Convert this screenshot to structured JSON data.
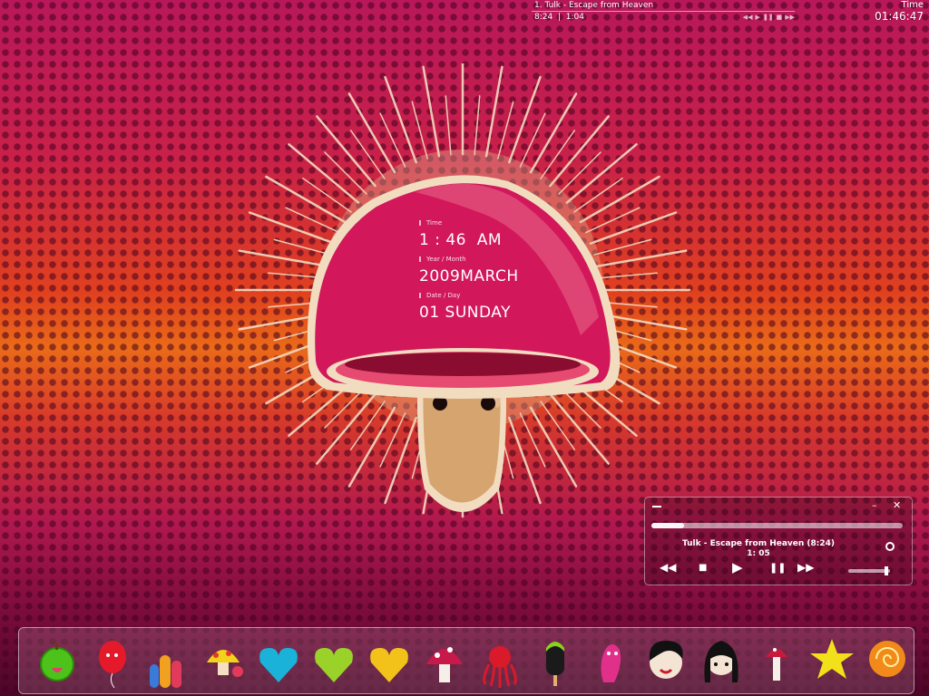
{
  "now_playing": {
    "title": "1. Tulk - Escape from Heaven",
    "total": "8:24",
    "separator": "|",
    "elapsed": "1:04"
  },
  "top_clock": {
    "label": "Time",
    "time": "01:46:47"
  },
  "widget": {
    "time_label": "Time",
    "time_value": "1 : 46  AM",
    "year_label": "Year / Month",
    "year_value": "2009MARCH",
    "date_label": "Date / Day",
    "date_value": "01 SUNDAY"
  },
  "player": {
    "track": "Tulk - Escape from Heaven (8:24)",
    "time": "1: 05",
    "progress": 0.13,
    "volume": 0.95
  },
  "dock": {
    "items": [
      "green-apple-icon",
      "red-balloon-icon",
      "candy-bars-icon",
      "yellow-mushroom-icon",
      "cyan-heart-icon",
      "green-heart-icon",
      "yellow-heart-icon",
      "red-mushroom-icon",
      "red-octopus-icon",
      "popsicle-icon",
      "pink-worm-icon",
      "emo-boy-icon",
      "emo-girl-icon",
      "small-mushroom-icon",
      "yellow-star-icon",
      "lollipop-icon"
    ]
  },
  "colors": {
    "cap": "#d81a5e",
    "stem": "#d9a878",
    "accent": "#ffffff"
  }
}
